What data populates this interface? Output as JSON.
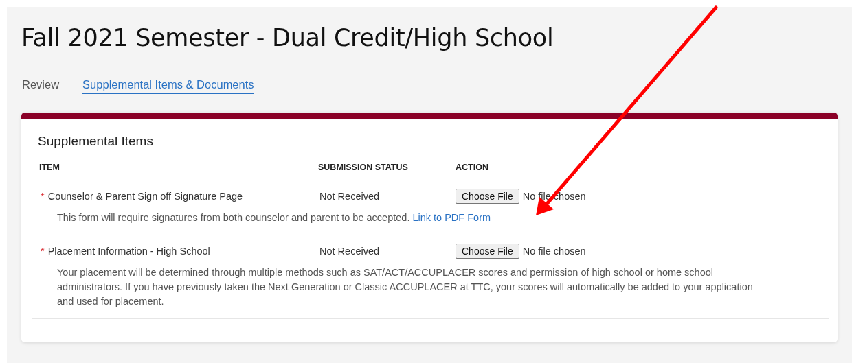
{
  "page_title": "Fall 2021 Semester - Dual Credit/High School",
  "tabs": [
    {
      "label": "Review",
      "selected": false
    },
    {
      "label": "Supplemental Items & Documents",
      "selected": true
    }
  ],
  "card": {
    "title": "Supplemental Items",
    "columns": [
      "ITEM",
      "SUBMISSION STATUS",
      "ACTION"
    ],
    "rows": [
      {
        "required_mark": "*",
        "item": "Counselor & Parent Sign off Signature Page",
        "status": "Not Received",
        "button": "Choose File",
        "file_status": "No file chosen",
        "note": "This form will require signatures from both counselor and parent to be accepted.",
        "link": "Link to PDF Form"
      },
      {
        "required_mark": "*",
        "item": "Placement Information - High School",
        "status": "Not Received",
        "button": "Choose File",
        "file_status": "No file chosen",
        "note": "Your placement will be determined through multiple methods such as SAT/ACT/ACCUPLACER scores and permission of high school or home school administrators. If you have previously taken the Next Generation or Classic ACCUPLACER at TTC, your scores will automatically be added to your application and used for placement."
      }
    ]
  },
  "annotation": {
    "kind": "arrow"
  }
}
